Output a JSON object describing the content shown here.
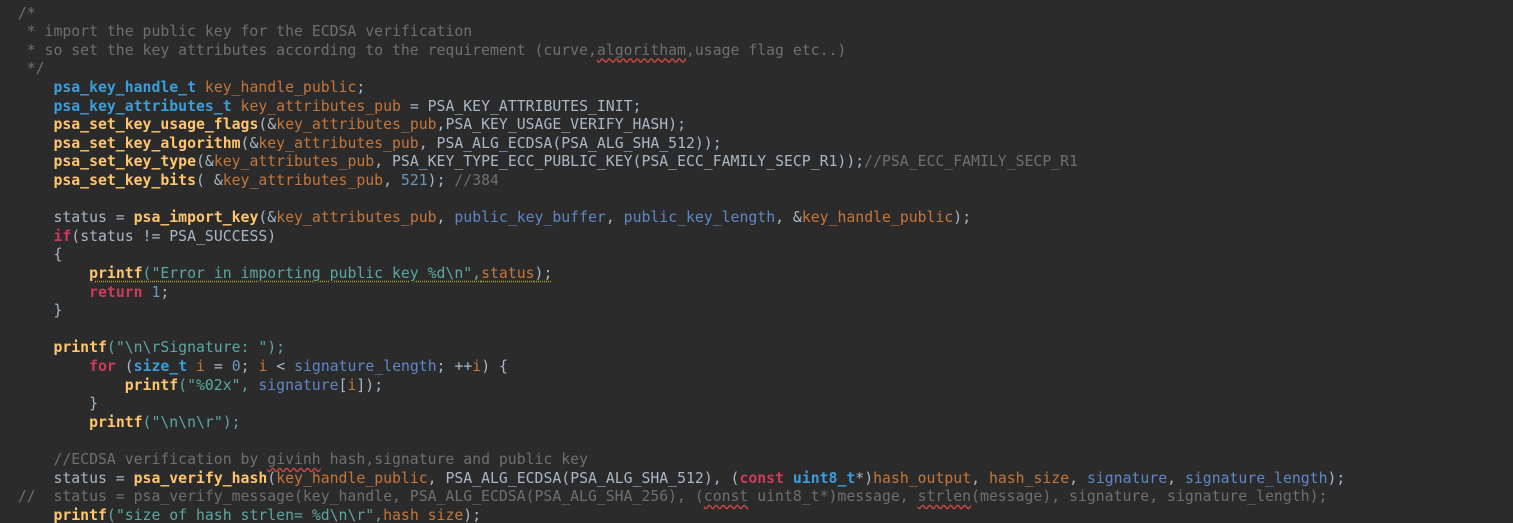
{
  "editor": {
    "background": "#2b2b2b",
    "colors": {
      "comment": "#6f6f6f",
      "function": "#ffc66d",
      "type": "#3a9edb",
      "variable": "#c5763a",
      "parameter": "#5f87c4",
      "keyword": "#cc3b5a",
      "string": "#5ba8a3",
      "number": "#6897bb",
      "plain": "#a9b7c6"
    },
    "lines": [
      [
        [
          "  /*",
          "cmt"
        ]
      ],
      [
        [
          "   * import the public key for the ECDSA verification",
          "cmt"
        ]
      ],
      [
        [
          "   * so set the key attributes according to the requirement (curve,",
          "cmt"
        ],
        [
          "algoritham",
          "cmt sq"
        ],
        [
          ",usage flag etc..)",
          "cmt"
        ]
      ],
      [
        [
          "   */",
          "cmt"
        ]
      ],
      [
        [
          "      "
        ],
        [
          "psa_key_handle_t",
          "typ"
        ],
        [
          " "
        ],
        [
          "key_handle_public",
          "var"
        ],
        [
          ";"
        ]
      ],
      [
        [
          "      "
        ],
        [
          "psa_key_attributes_t",
          "typ"
        ],
        [
          " "
        ],
        [
          "key_attributes_pub",
          "var"
        ],
        [
          " = PSA_KEY_ATTRIBUTES_INIT;"
        ]
      ],
      [
        [
          "      "
        ],
        [
          "psa_set_key_usage_flags",
          "fn"
        ],
        [
          "(&"
        ],
        [
          "key_attributes_pub",
          "var"
        ],
        [
          ",PSA_KEY_USAGE_VERIFY_HASH);"
        ]
      ],
      [
        [
          "      "
        ],
        [
          "psa_set_key_algorithm",
          "fn"
        ],
        [
          "(&"
        ],
        [
          "key_attributes_pub",
          "var"
        ],
        [
          ", PSA_ALG_ECDSA(PSA_ALG_SHA_512));"
        ]
      ],
      [
        [
          "      "
        ],
        [
          "psa_set_key_type",
          "fn"
        ],
        [
          "(&"
        ],
        [
          "key_attributes_pub",
          "var"
        ],
        [
          ", PSA_KEY_TYPE_ECC_PUBLIC_KEY(PSA_ECC_FAMILY_SECP_R1));"
        ],
        [
          "//PSA_ECC_FAMILY_SECP_R1",
          "cmt"
        ]
      ],
      [
        [
          "      "
        ],
        [
          "psa_set_key_bits",
          "fn"
        ],
        [
          "( &"
        ],
        [
          "key_attributes_pub",
          "var"
        ],
        [
          ", "
        ],
        [
          "521",
          "num"
        ],
        [
          "); "
        ],
        [
          "//384",
          "cmt"
        ]
      ],
      [],
      [
        [
          "      status = "
        ],
        [
          "psa_import_key",
          "fn"
        ],
        [
          "(&"
        ],
        [
          "key_attributes_pub",
          "var"
        ],
        [
          ", "
        ],
        [
          "public_key_buffer",
          "prm"
        ],
        [
          ", "
        ],
        [
          "public_key_length",
          "prm"
        ],
        [
          ", &"
        ],
        [
          "key_handle_public",
          "var"
        ],
        [
          ");"
        ]
      ],
      [
        [
          "      "
        ],
        [
          "if",
          "kw"
        ],
        [
          "(status != PSA_SUCCESS)"
        ]
      ],
      [
        [
          "      {"
        ]
      ],
      [
        [
          "          "
        ],
        [
          "printf",
          "fn wq"
        ],
        [
          "(\"Error in importing public key %d\\n\",",
          "str wq"
        ],
        [
          "status",
          "var wq"
        ],
        [
          ");",
          "txt wq"
        ]
      ],
      [
        [
          "          "
        ],
        [
          "return",
          "kw"
        ],
        [
          " "
        ],
        [
          "1",
          "num"
        ],
        [
          ";"
        ]
      ],
      [
        [
          "      }"
        ]
      ],
      [],
      [
        [
          "      "
        ],
        [
          "printf",
          "fn"
        ],
        [
          "(\"\\n\\rSignature: \");",
          "str"
        ]
      ],
      [
        [
          "          "
        ],
        [
          "for",
          "kw"
        ],
        [
          " ("
        ],
        [
          "size_t",
          "typ"
        ],
        [
          " "
        ],
        [
          "i",
          "var"
        ],
        [
          " = "
        ],
        [
          "0",
          "num"
        ],
        [
          "; "
        ],
        [
          "i",
          "var"
        ],
        [
          " < "
        ],
        [
          "signature_length",
          "prm"
        ],
        [
          "; ++"
        ],
        [
          "i",
          "var"
        ],
        [
          ") {"
        ]
      ],
      [
        [
          "              "
        ],
        [
          "printf",
          "fn"
        ],
        [
          "(\"%02x\", ",
          "str"
        ],
        [
          "signature",
          "prm"
        ],
        [
          "["
        ],
        [
          "i",
          "var"
        ],
        [
          "]);"
        ]
      ],
      [
        [
          "          }"
        ]
      ],
      [
        [
          "          "
        ],
        [
          "printf",
          "fn"
        ],
        [
          "(\"\\n\\n\\r\");",
          "str"
        ]
      ],
      [],
      [
        [
          "      //ECDSA verification by ",
          "cmt"
        ],
        [
          "givinh",
          "cmt sq"
        ],
        [
          " hash,signature and public key",
          "cmt"
        ]
      ],
      [
        [
          "      status = "
        ],
        [
          "psa_verify_hash",
          "fn"
        ],
        [
          "("
        ],
        [
          "key_handle_public",
          "var"
        ],
        [
          ", PSA_ALG_ECDSA(PSA_ALG_SHA_512), ("
        ],
        [
          "const",
          "kw"
        ],
        [
          " "
        ],
        [
          "uint8_t",
          "typ"
        ],
        [
          "*)"
        ],
        [
          "hash_output",
          "var"
        ],
        [
          ", "
        ],
        [
          "hash_size",
          "var"
        ],
        [
          ", "
        ],
        [
          "signature",
          "prm"
        ],
        [
          ", "
        ],
        [
          "signature_length",
          "prm"
        ],
        [
          ");"
        ]
      ],
      [
        [
          "  //  status = psa_verify_message(key_handle, PSA_ALG_ECDSA(PSA_ALG_SHA_256), (",
          "cmt"
        ],
        [
          "const",
          "cmt sq"
        ],
        [
          " uint8_t*)message, ",
          "cmt"
        ],
        [
          "strlen",
          "cmt sq"
        ],
        [
          "(message), signature, signature_length);",
          "cmt"
        ]
      ],
      [
        [
          "      "
        ],
        [
          "printf",
          "fn"
        ],
        [
          "(\"size of hash ",
          "str"
        ],
        [
          "strlen",
          "str sq"
        ],
        [
          "= %d\\n\\r\",",
          "str"
        ],
        [
          "hash_size",
          "var"
        ],
        [
          ");"
        ]
      ],
      [
        [
          "      "
        ],
        [
          "// ...",
          "cmt"
        ]
      ]
    ]
  }
}
